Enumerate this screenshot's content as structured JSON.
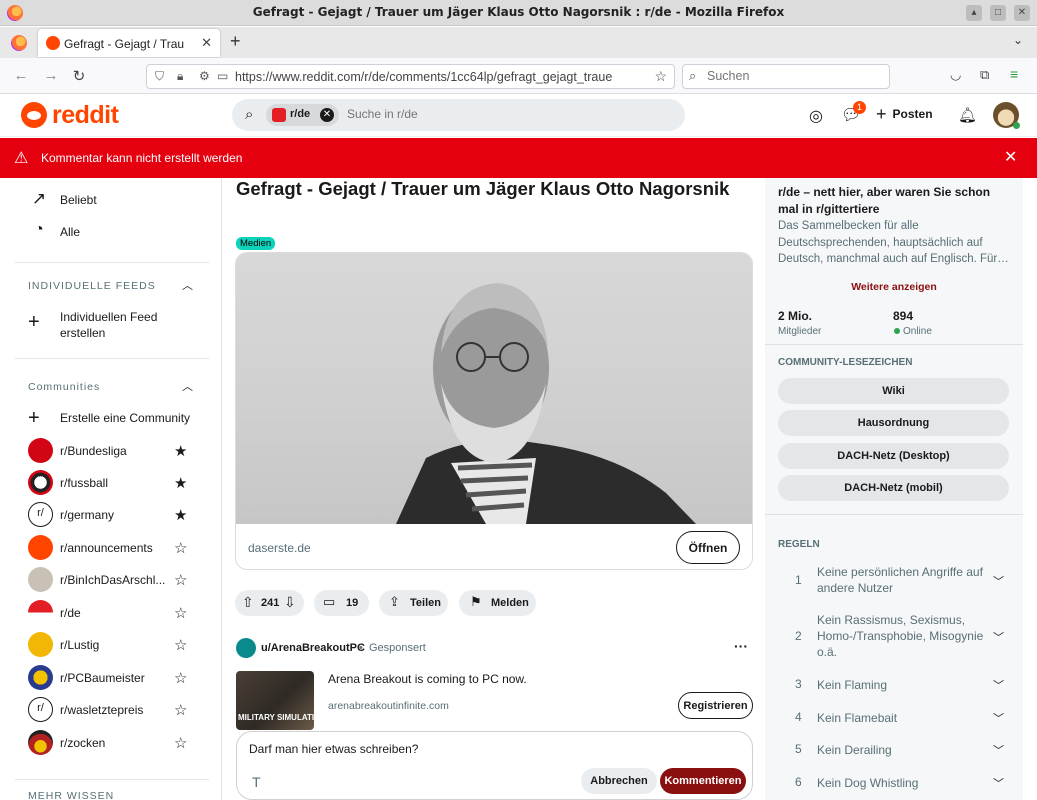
{
  "window": {
    "title": "Gefragt - Gejagt / Trauer um Jäger Klaus Otto Nagorsnik : r/de - Mozilla Firefox"
  },
  "browser": {
    "tab_label": "Gefragt - Gejagt / Trau",
    "url": "https://www.reddit.com/r/de/comments/1cc64lp/gefragt_gejagt_traue",
    "search_placeholder": "Suchen"
  },
  "reddit_header": {
    "logo_text": "reddit",
    "search_chip": "r/de",
    "search_placeholder": "Suche in r/de",
    "chat_badge": "1",
    "post_label": "Posten"
  },
  "banner": {
    "message": "Kommentar kann nicht erstellt werden"
  },
  "left_sidebar": {
    "top_items": [
      {
        "label": "Beliebt"
      },
      {
        "label": "Alle"
      }
    ],
    "custom_feeds_heading": "INDIVIDUELLE FEEDS",
    "create_feed_label": "Individuellen Feed erstellen",
    "communities_heading": "Communities",
    "create_community_label": "Erstelle eine Community",
    "communities": [
      {
        "name": "r/Bundesliga",
        "starred": true,
        "color": "#d20515"
      },
      {
        "name": "r/fussball",
        "starred": true,
        "color": "#222222"
      },
      {
        "name": "r/germany",
        "starred": true,
        "color": "#ffffff"
      },
      {
        "name": "r/announcements",
        "starred": false,
        "color": "#ff4500"
      },
      {
        "name": "r/BinIchDasArschl...",
        "starred": false,
        "color": "#c9c1b5"
      },
      {
        "name": "r/de",
        "starred": false,
        "color": "#e31e24"
      },
      {
        "name": "r/Lustig",
        "starred": false,
        "color": "#f2b705"
      },
      {
        "name": "r/PCBaumeister",
        "starred": false,
        "color": "#2a3b8f"
      },
      {
        "name": "r/wasletztepreis",
        "starred": false,
        "color": "#ffffff"
      },
      {
        "name": "r/zocken",
        "starred": false,
        "color": "#b22222"
      }
    ],
    "more_heading": "MEHR WISSEN"
  },
  "post": {
    "title": "Gefragt - Gejagt / Trauer um Jäger Klaus Otto Nagorsnik",
    "flair": "Medien",
    "link_domain": "daserste.de",
    "open_label": "Öffnen",
    "votes": "241",
    "comments": "19",
    "share_label": "Teilen",
    "report_label": "Melden"
  },
  "ad": {
    "user": "u/ArenaBreakoutPC",
    "sponsored": "Gesponsert",
    "text": "Arena Breakout is coming to PC now.",
    "domain": "arenabreakoutinfinite.com",
    "thumb_caption": "MILITARY SIMULATION",
    "register_label": "Registrieren"
  },
  "comment_box": {
    "value": "Darf man hier etwas schreiben?",
    "cancel_label": "Abbrechen",
    "submit_label": "Kommentieren"
  },
  "right_sidebar": {
    "title": "r/de – nett hier, aber waren Sie schon mal in r/gittertiere",
    "description": "Das Sammelbecken für alle Deutschsprechenden, hauptsächlich auf Deutsch, manchmal auch auf Englisch. Für…",
    "show_more": "Weitere anzeigen",
    "members_value": "2 Mio.",
    "members_label": "Mitglieder",
    "online_value": "894",
    "online_label": "Online",
    "bookmarks_heading": "COMMUNITY-LESEZEICHEN",
    "bookmarks": [
      "Wiki",
      "Hausordnung",
      "DACH-Netz (Desktop)",
      "DACH-Netz (mobil)"
    ],
    "rules_heading": "REGELN",
    "rules": [
      {
        "n": "1",
        "text": "Keine persönlichen Angriffe auf andere Nutzer"
      },
      {
        "n": "2",
        "text": "Kein Rassismus, Sexismus, Homo-/Transphobie, Misogynie o.ä."
      },
      {
        "n": "3",
        "text": "Kein Flaming"
      },
      {
        "n": "4",
        "text": "Kein Flamebait"
      },
      {
        "n": "5",
        "text": "Kein Derailing"
      },
      {
        "n": "6",
        "text": "Kein Dog Whistling"
      }
    ]
  },
  "colors": {
    "reddit_orange": "#ff4500",
    "banner_red": "#e4000f",
    "comment_button": "#8a0f0f",
    "flair_teal": "#0dd3bb",
    "online_green": "#2ea44f"
  }
}
